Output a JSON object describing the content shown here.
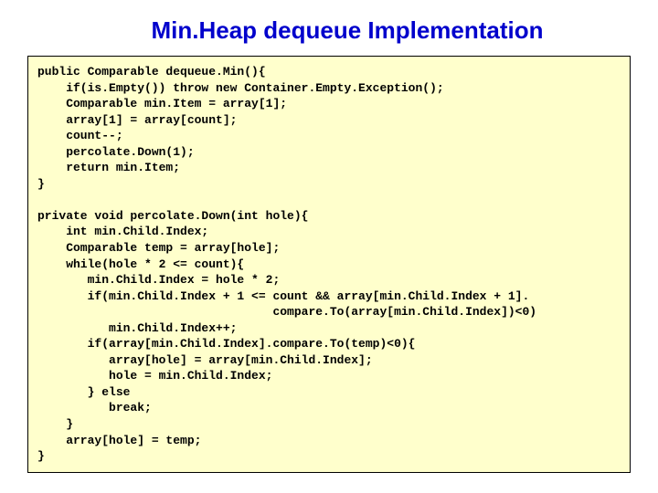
{
  "title": "Min.Heap dequeue Implementation",
  "code": "public Comparable dequeue.Min(){\n    if(is.Empty()) throw new Container.Empty.Exception();\n    Comparable min.Item = array[1];\n    array[1] = array[count];\n    count--;\n    percolate.Down(1);\n    return min.Item;\n}\n\nprivate void percolate.Down(int hole){\n    int min.Child.Index;\n    Comparable temp = array[hole];\n    while(hole * 2 <= count){\n       min.Child.Index = hole * 2;\n       if(min.Child.Index + 1 <= count && array[min.Child.Index + 1].\n                                 compare.To(array[min.Child.Index])<0)\n          min.Child.Index++;\n       if(array[min.Child.Index].compare.To(temp)<0){\n          array[hole] = array[min.Child.Index];\n          hole = min.Child.Index;\n       } else\n          break;\n    }\n    array[hole] = temp;\n}"
}
